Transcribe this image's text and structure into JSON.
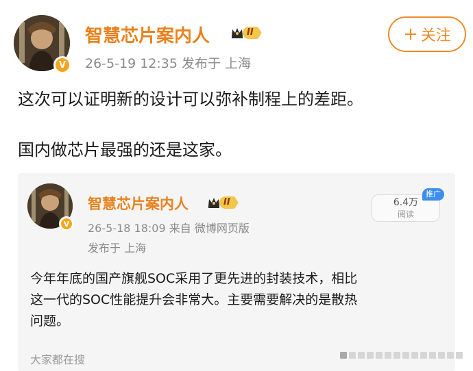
{
  "post": {
    "author": "智慧芯片案内人",
    "level": "II",
    "verified_badge": "V",
    "meta": "26-5-19 12:35   发布于 上海",
    "follow_label": "关注",
    "follow_plus": "+",
    "lines": [
      "这次可以证明新的设计可以弥补制程上的差距。",
      "国内做芯片最强的还是这家。"
    ]
  },
  "repost": {
    "author": "智慧芯片案内人",
    "level": "II",
    "verified_badge": "V",
    "meta_line1": "26-5-18 18:09   来自 微博网页版",
    "meta_line2": "发布于 上海",
    "views_count": "6.4万",
    "views_label": "阅读",
    "promo_tag": "推广",
    "lines": [
      "今年年底的国产旗舰SOC采用了更先进的封装技术，相比",
      "这一代的SOC性能提升会非常大。主要需要解决的是散热",
      "问题。"
    ],
    "search_hint": "大家都在搜"
  },
  "colors": {
    "brand_orange": "#e8821e",
    "follow_orange": "#f08a28",
    "meta_gray": "#8a8a8a",
    "repost_bg": "#f5f5f5",
    "promo_blue": "#3d8ef0"
  },
  "icons": {
    "crown": "crown-icon",
    "verified": "verified-v-icon",
    "plus": "plus-icon"
  }
}
